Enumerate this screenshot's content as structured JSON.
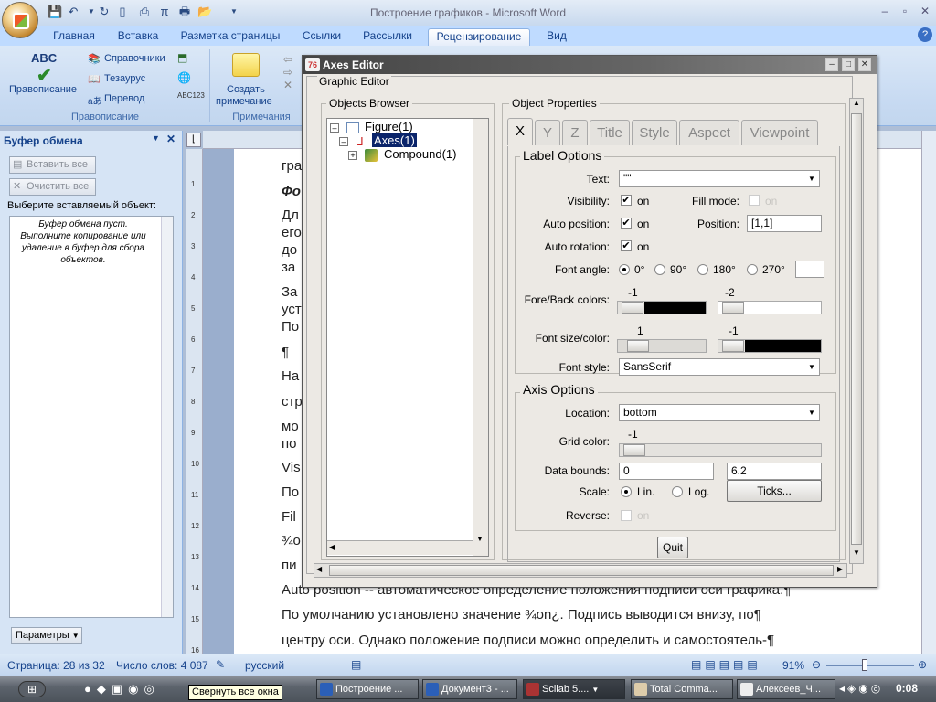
{
  "word": {
    "title": "Построение графиков - Microsoft Word",
    "tabs": [
      "Главная",
      "Вставка",
      "Разметка страницы",
      "Ссылки",
      "Рассылки",
      "Рецензирование",
      "Вид"
    ],
    "active_tab": "Рецензирование",
    "ribbon": {
      "spelling_btn": "Правописание",
      "references_btn": "Справочники",
      "thesaurus_btn": "Тезаурус",
      "translate_btn": "Перевод",
      "group_spelling": "Правописание",
      "new_comment_line1": "Создать",
      "new_comment_line2": "примечание",
      "group_comments": "Примечания"
    },
    "clipboard": {
      "title": "Буфер обмена",
      "paste_all": "Вставить все",
      "clear_all": "Очистить все",
      "select_label": "Выберите вставляемый объект:",
      "empty_msg": "Буфер обмена пуст. Выполните копирование или удаление в буфер для сбора объектов.",
      "params": "Параметры"
    },
    "doc_lines": [
      "гра",
      "Фо",
      "Дл",
      "его",
      "до",
      "за",
      "За",
      "уст",
      "По",
      "¶",
      "На",
      "стр",
      "мо",
      "по",
      "Vis",
      "По",
      "Fil",
      "¾о",
      "пи",
      "Auto position -- автоматическое определение положения подписи оси графика.¶",
      "По умолчанию установлено значение ¾on¿. Подпись выводится внизу, по¶",
      "центру оси. Однако положение подписи можно определить и самостоятель-¶"
    ],
    "status": {
      "page": "Страница: 28 из 32",
      "words": "Число слов: 4 087",
      "lang": "русский",
      "zoom": "91%"
    }
  },
  "taskbar": {
    "tooltip": "Свернуть все окна",
    "buttons": [
      "Построение ...",
      "Документ3 - ...",
      "Scilab 5....",
      "Total Comma...",
      "Алексеев_Ч..."
    ],
    "clock": "0:08"
  },
  "dialog": {
    "title": "Axes Editor",
    "menu": "Graphic Editor",
    "objects_browser": "Objects Browser",
    "object_properties": "Object Properties",
    "tree": [
      "Figure(1)",
      "Axes(1)",
      "Compound(1)"
    ],
    "tabs": [
      "X",
      "Y",
      "Z",
      "Title",
      "Style",
      "Aspect",
      "Viewpoint"
    ],
    "label_options": {
      "legend": "Label Options",
      "text_label": "Text:",
      "text_value": "\"\"",
      "visibility_label": "Visibility:",
      "visibility_value": "on",
      "fill_mode_label": "Fill mode:",
      "fill_mode_value": "on",
      "auto_position_label": "Auto position:",
      "auto_position_value": "on",
      "position_label": "Position:",
      "position_value": "[1,1]",
      "auto_rotation_label": "Auto rotation:",
      "auto_rotation_value": "on",
      "font_angle_label": "Font angle:",
      "angles": [
        "0°",
        "90°",
        "180°",
        "270°"
      ],
      "fore_back_label": "Fore/Back colors:",
      "fore_value": "-1",
      "back_value": "-2",
      "font_size_color_label": "Font size/color:",
      "font_size_value": "1",
      "font_color_value": "-1",
      "font_style_label": "Font style:",
      "font_style_value": "SansSerif"
    },
    "axis_options": {
      "legend": "Axis Options",
      "location_label": "Location:",
      "location_value": "bottom",
      "grid_color_label": "Grid color:",
      "grid_color_value": "-1",
      "data_bounds_label": "Data bounds:",
      "data_bounds_min": "0",
      "data_bounds_max": "6.2",
      "scale_label": "Scale:",
      "scale_lin": "Lin.",
      "scale_log": "Log.",
      "ticks_btn": "Ticks...",
      "reverse_label": "Reverse:",
      "reverse_value": "on"
    },
    "quit_btn": "Quit"
  },
  "colors": {
    "ribbon_bg": "#c7daf2",
    "word_blue": "#15428b",
    "selection": "#0a246a"
  }
}
